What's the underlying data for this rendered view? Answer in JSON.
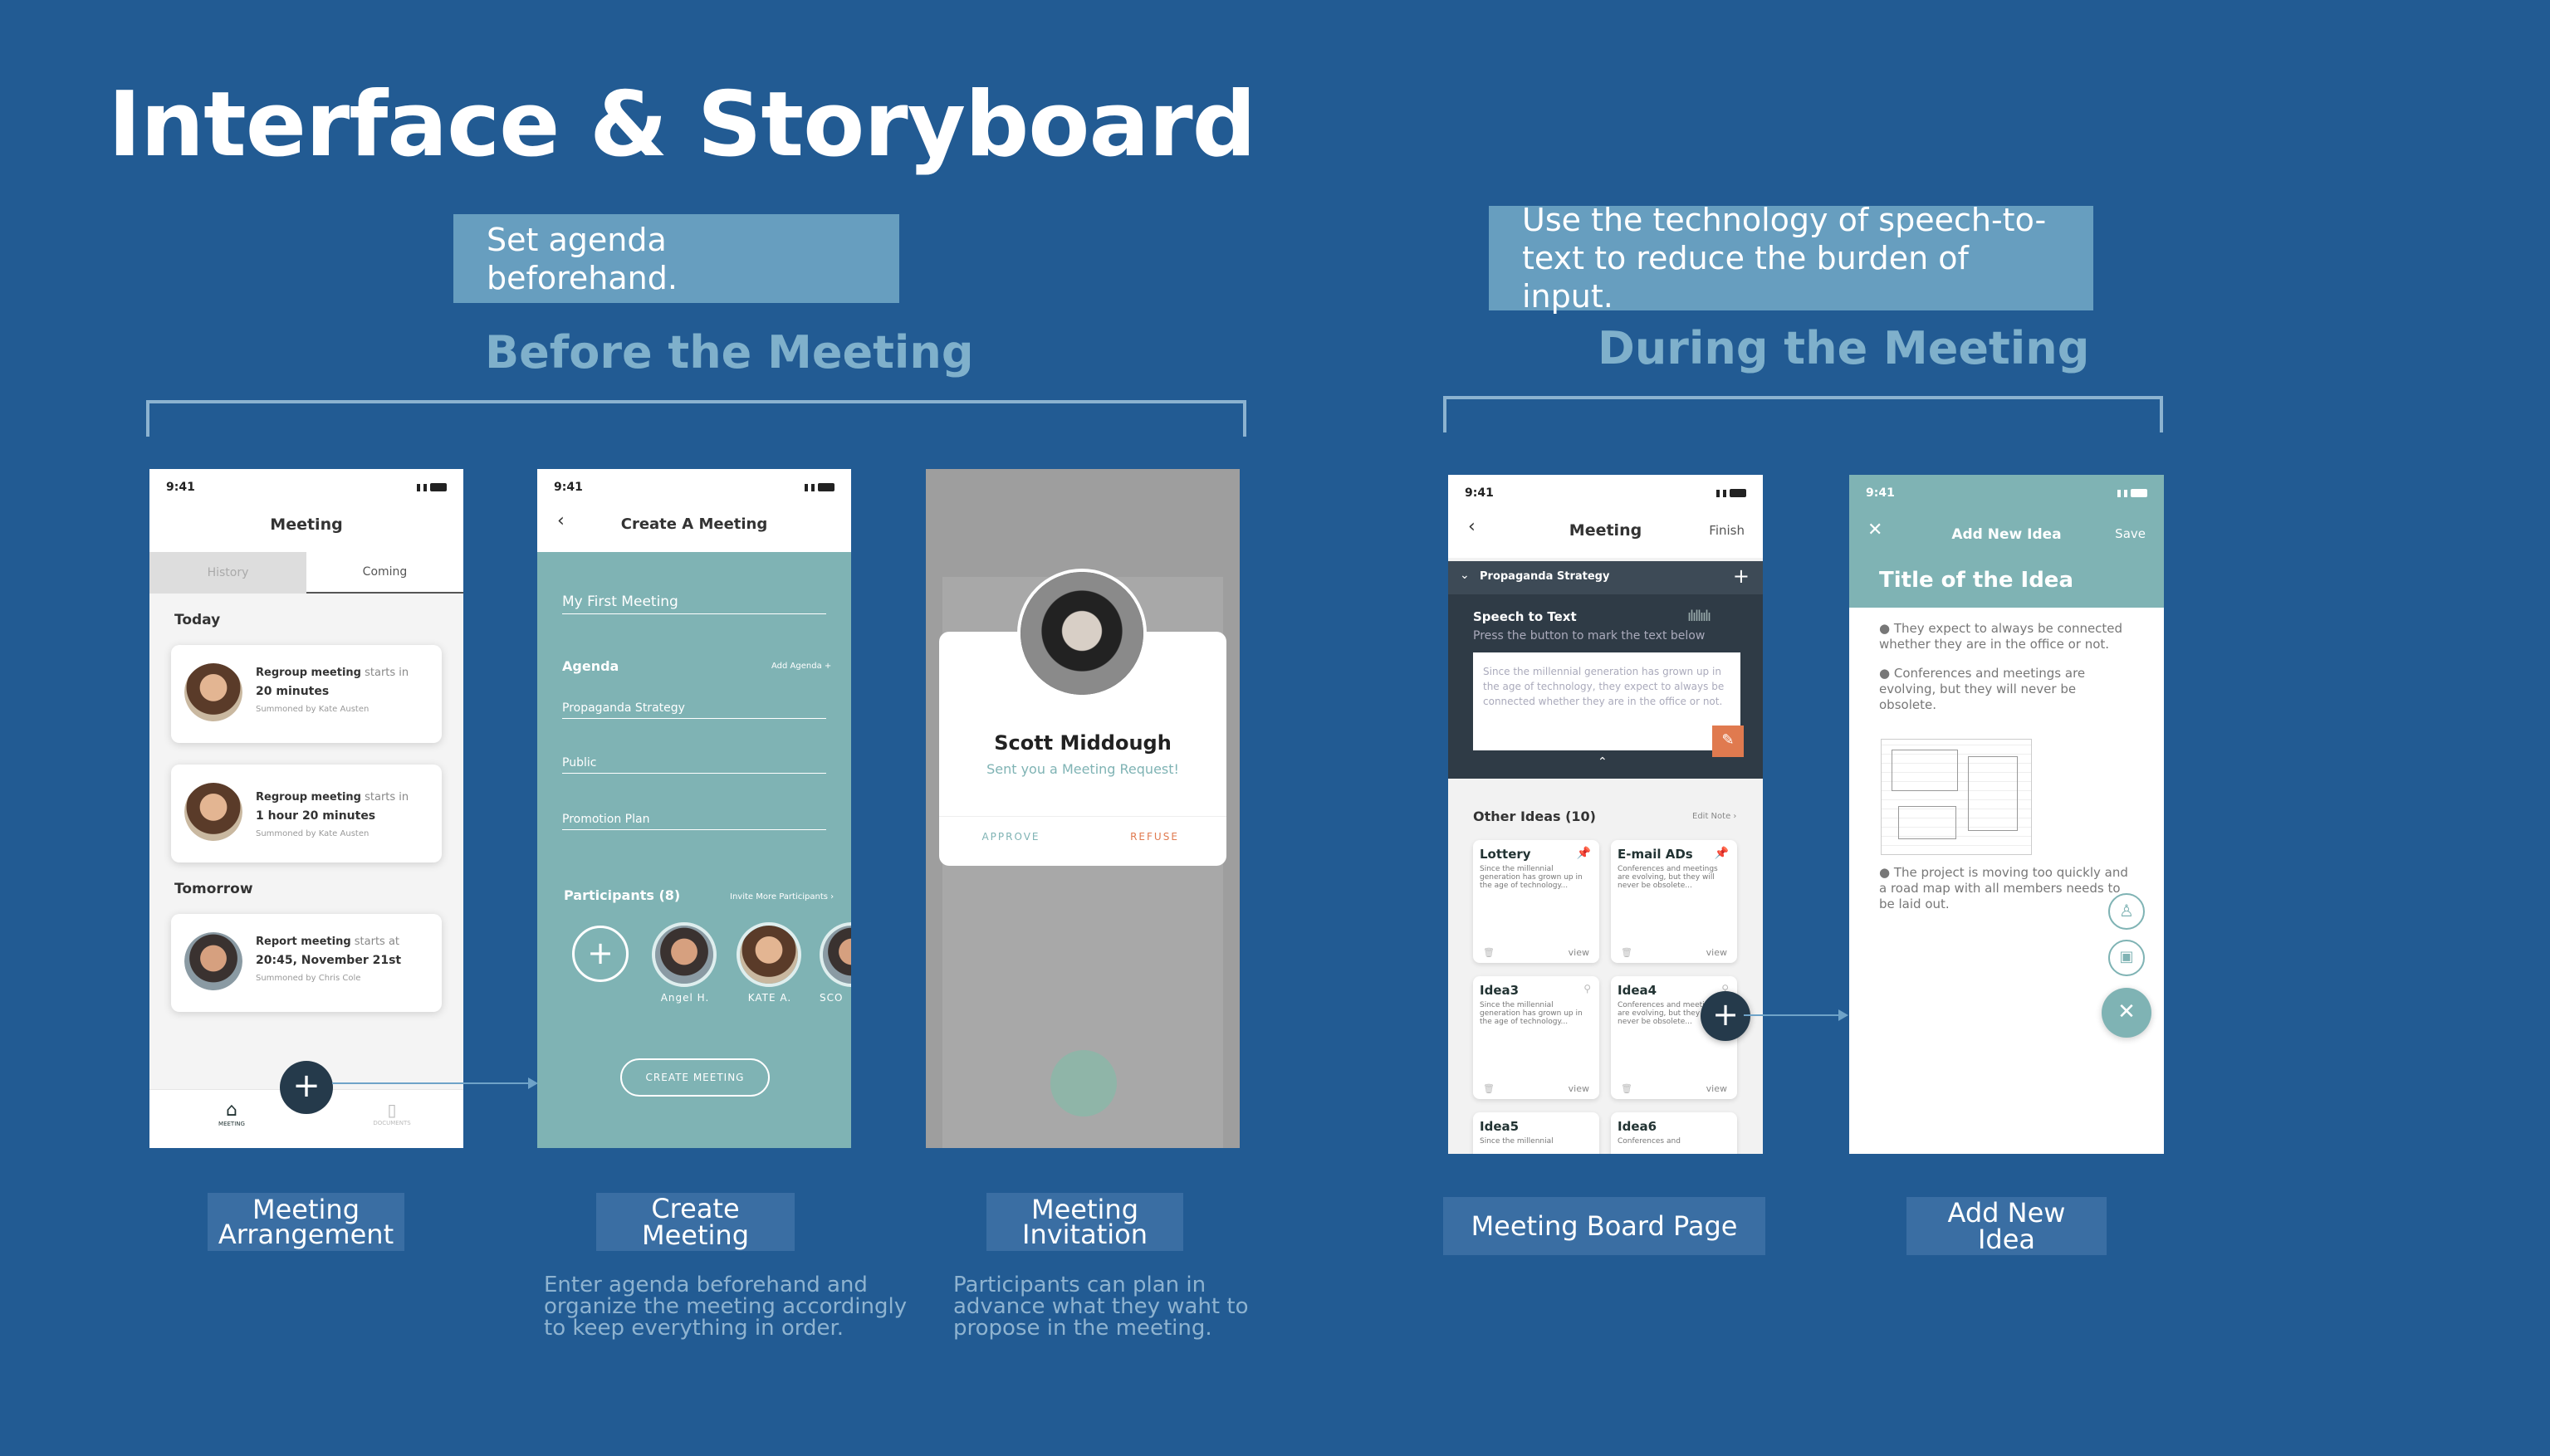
{
  "page_title": "Interface & Storyboard",
  "callouts": {
    "before": "Set agenda beforehand.",
    "during_line1": "Use the technology of speech-to-",
    "during_line2": "text to reduce the burden of input."
  },
  "phases": {
    "before": "Before the Meeting",
    "during": "During the Meeting"
  },
  "screen_labels": {
    "arrangement_1": "Meeting",
    "arrangement_2": "Arrangement",
    "create": "Create Meeting",
    "invitation_1": "Meeting",
    "invitation_2": "Invitation",
    "board": "Meeting Board Page",
    "add_idea": "Add New Idea"
  },
  "descriptions": {
    "create": "Enter agenda beforehand and\norganize the meeting accordingly\nto keep everything in order.",
    "invitation": "Participants can plan in\nadvance what they waht to\npropose in the  meeting."
  },
  "status_time": "9:41",
  "arrangement": {
    "header": "Meeting",
    "tab_history": "History",
    "tab_coming": "Coming",
    "today": "Today",
    "tomorrow": "Tomorrow",
    "cards": [
      {
        "title": "Regroup meeting",
        "starts": "starts in",
        "time": "20 minutes",
        "by": "Summoned by Kate Austen"
      },
      {
        "title": "Regroup meeting",
        "starts": "starts in",
        "time": "1 hour  20 minutes",
        "by": "Summoned by Kate Austen"
      },
      {
        "title": "Report meeting",
        "starts": "starts at",
        "time": "20:45, November 21st",
        "by": "Summoned by Chris Cole"
      }
    ],
    "nav_meeting": "MEETING",
    "nav_documents": "DOCUMENTS"
  },
  "create": {
    "header": "Create A Meeting",
    "meeting_name": "My First Meeting",
    "agenda_label": "Agenda",
    "add_agenda": "Add Agenda",
    "agenda_items": [
      "Propaganda Strategy",
      "Public",
      "Promotion Plan"
    ],
    "participants_label": "Participants (8)",
    "invite_more": "Invite More Participants",
    "participants": [
      "Angel H.",
      "KATE A.",
      "SCO"
    ],
    "button": "CREATE MEETING"
  },
  "invitation": {
    "name": "Scott Middough",
    "message": "Sent you a Meeting Request!",
    "approve": "APPROVE",
    "refuse": "REFUSE"
  },
  "board": {
    "header": "Meeting",
    "finish": "Finish",
    "section": "Propaganda Strategy",
    "stt_title": "Speech to Text",
    "stt_hint": "Press the button to mark the text below",
    "stt_text": "Since the millennial generation has grown up in the age of technology, they expect to always be connected whether they are in the office or not.",
    "other_ideas": "Other Ideas (10)",
    "edit_note": "Edit Note",
    "ideas": [
      {
        "title": "Lottery",
        "text": "Since the millennial generation has grown up in the age of technology...",
        "view": "view"
      },
      {
        "title": "E-mail ADs",
        "text": "Conferences and meetings are evolving, but they will never be obsolete...",
        "view": "view"
      },
      {
        "title": "Idea3",
        "text": "Since the millennial generation has grown up in the age of technology...",
        "view": "view"
      },
      {
        "title": "Idea4",
        "text": "Conferences and meetings are evolving, but they will never be obsolete...",
        "view": "view"
      },
      {
        "title": "Idea5",
        "text": "Since the millennial",
        "view": ""
      },
      {
        "title": "Idea6",
        "text": "Conferences and",
        "view": ""
      }
    ]
  },
  "add_idea": {
    "header": "Add New Idea",
    "save": "Save",
    "title": "Title of the Idea",
    "bullets": [
      "They expect to always be connected whether they are in the office or not.",
      "Conferences and meetings are evolving, but they will never be obsolete.",
      "The project is moving too quickly and a road map with all members needs to be laid out."
    ]
  },
  "colors": {
    "background": "#225b93",
    "teal": "#7fb3b4",
    "callout": "#679ebf",
    "accent_orange": "#e07a4f"
  }
}
